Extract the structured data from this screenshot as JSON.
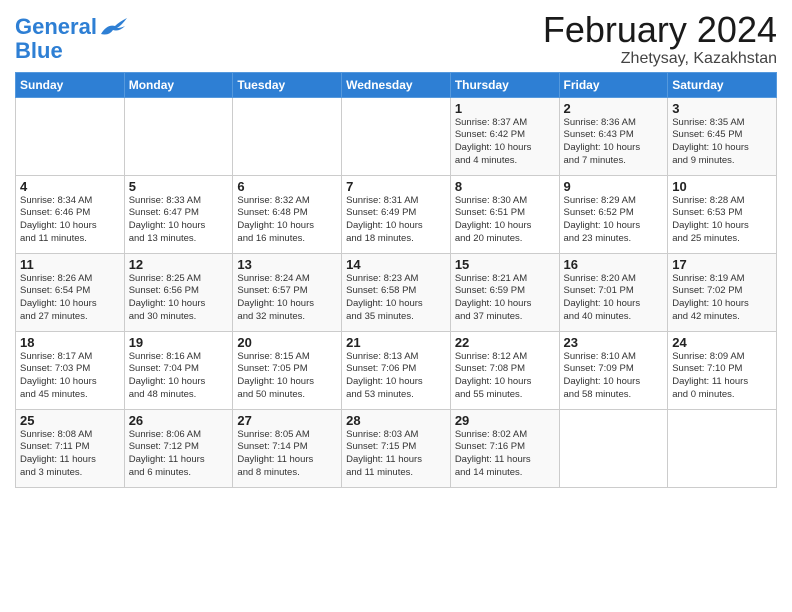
{
  "header": {
    "logo_line1": "General",
    "logo_line2": "Blue",
    "title": "February 2024",
    "subtitle": "Zhetysay, Kazakhstan"
  },
  "days_of_week": [
    "Sunday",
    "Monday",
    "Tuesday",
    "Wednesday",
    "Thursday",
    "Friday",
    "Saturday"
  ],
  "weeks": [
    [
      {
        "day": "",
        "info": ""
      },
      {
        "day": "",
        "info": ""
      },
      {
        "day": "",
        "info": ""
      },
      {
        "day": "",
        "info": ""
      },
      {
        "day": "1",
        "info": "Sunrise: 8:37 AM\nSunset: 6:42 PM\nDaylight: 10 hours\nand 4 minutes."
      },
      {
        "day": "2",
        "info": "Sunrise: 8:36 AM\nSunset: 6:43 PM\nDaylight: 10 hours\nand 7 minutes."
      },
      {
        "day": "3",
        "info": "Sunrise: 8:35 AM\nSunset: 6:45 PM\nDaylight: 10 hours\nand 9 minutes."
      }
    ],
    [
      {
        "day": "4",
        "info": "Sunrise: 8:34 AM\nSunset: 6:46 PM\nDaylight: 10 hours\nand 11 minutes."
      },
      {
        "day": "5",
        "info": "Sunrise: 8:33 AM\nSunset: 6:47 PM\nDaylight: 10 hours\nand 13 minutes."
      },
      {
        "day": "6",
        "info": "Sunrise: 8:32 AM\nSunset: 6:48 PM\nDaylight: 10 hours\nand 16 minutes."
      },
      {
        "day": "7",
        "info": "Sunrise: 8:31 AM\nSunset: 6:49 PM\nDaylight: 10 hours\nand 18 minutes."
      },
      {
        "day": "8",
        "info": "Sunrise: 8:30 AM\nSunset: 6:51 PM\nDaylight: 10 hours\nand 20 minutes."
      },
      {
        "day": "9",
        "info": "Sunrise: 8:29 AM\nSunset: 6:52 PM\nDaylight: 10 hours\nand 23 minutes."
      },
      {
        "day": "10",
        "info": "Sunrise: 8:28 AM\nSunset: 6:53 PM\nDaylight: 10 hours\nand 25 minutes."
      }
    ],
    [
      {
        "day": "11",
        "info": "Sunrise: 8:26 AM\nSunset: 6:54 PM\nDaylight: 10 hours\nand 27 minutes."
      },
      {
        "day": "12",
        "info": "Sunrise: 8:25 AM\nSunset: 6:56 PM\nDaylight: 10 hours\nand 30 minutes."
      },
      {
        "day": "13",
        "info": "Sunrise: 8:24 AM\nSunset: 6:57 PM\nDaylight: 10 hours\nand 32 minutes."
      },
      {
        "day": "14",
        "info": "Sunrise: 8:23 AM\nSunset: 6:58 PM\nDaylight: 10 hours\nand 35 minutes."
      },
      {
        "day": "15",
        "info": "Sunrise: 8:21 AM\nSunset: 6:59 PM\nDaylight: 10 hours\nand 37 minutes."
      },
      {
        "day": "16",
        "info": "Sunrise: 8:20 AM\nSunset: 7:01 PM\nDaylight: 10 hours\nand 40 minutes."
      },
      {
        "day": "17",
        "info": "Sunrise: 8:19 AM\nSunset: 7:02 PM\nDaylight: 10 hours\nand 42 minutes."
      }
    ],
    [
      {
        "day": "18",
        "info": "Sunrise: 8:17 AM\nSunset: 7:03 PM\nDaylight: 10 hours\nand 45 minutes."
      },
      {
        "day": "19",
        "info": "Sunrise: 8:16 AM\nSunset: 7:04 PM\nDaylight: 10 hours\nand 48 minutes."
      },
      {
        "day": "20",
        "info": "Sunrise: 8:15 AM\nSunset: 7:05 PM\nDaylight: 10 hours\nand 50 minutes."
      },
      {
        "day": "21",
        "info": "Sunrise: 8:13 AM\nSunset: 7:06 PM\nDaylight: 10 hours\nand 53 minutes."
      },
      {
        "day": "22",
        "info": "Sunrise: 8:12 AM\nSunset: 7:08 PM\nDaylight: 10 hours\nand 55 minutes."
      },
      {
        "day": "23",
        "info": "Sunrise: 8:10 AM\nSunset: 7:09 PM\nDaylight: 10 hours\nand 58 minutes."
      },
      {
        "day": "24",
        "info": "Sunrise: 8:09 AM\nSunset: 7:10 PM\nDaylight: 11 hours\nand 0 minutes."
      }
    ],
    [
      {
        "day": "25",
        "info": "Sunrise: 8:08 AM\nSunset: 7:11 PM\nDaylight: 11 hours\nand 3 minutes."
      },
      {
        "day": "26",
        "info": "Sunrise: 8:06 AM\nSunset: 7:12 PM\nDaylight: 11 hours\nand 6 minutes."
      },
      {
        "day": "27",
        "info": "Sunrise: 8:05 AM\nSunset: 7:14 PM\nDaylight: 11 hours\nand 8 minutes."
      },
      {
        "day": "28",
        "info": "Sunrise: 8:03 AM\nSunset: 7:15 PM\nDaylight: 11 hours\nand 11 minutes."
      },
      {
        "day": "29",
        "info": "Sunrise: 8:02 AM\nSunset: 7:16 PM\nDaylight: 11 hours\nand 14 minutes."
      },
      {
        "day": "",
        "info": ""
      },
      {
        "day": "",
        "info": ""
      }
    ]
  ]
}
